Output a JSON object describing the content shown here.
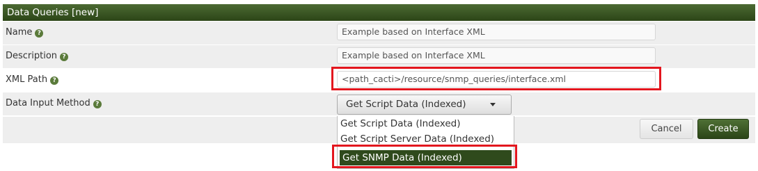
{
  "panel": {
    "title": "Data Queries [new]"
  },
  "form": {
    "name": {
      "label": "Name",
      "value": "Example based on Interface XML"
    },
    "description": {
      "label": "Description",
      "value": "Example based on Interface XML"
    },
    "xml_path": {
      "label": "XML Path",
      "value": "<path_cacti>/resource/snmp_queries/interface.xml"
    },
    "data_input_method": {
      "label": "Data Input Method",
      "selected": "Get Script Data (Indexed)",
      "options": [
        "Get Script Data (Indexed)",
        "Get Script Server Data (Indexed)",
        "Get SNMP Data (Indexed)"
      ],
      "highlighted_option": "Get SNMP Data (Indexed)"
    }
  },
  "help_icon_glyph": "?",
  "buttons": {
    "cancel": "Cancel",
    "create": "Create"
  },
  "colors": {
    "header": "#3a5624",
    "highlight": "#e3161e",
    "selected_option": "#2f4a1c"
  }
}
